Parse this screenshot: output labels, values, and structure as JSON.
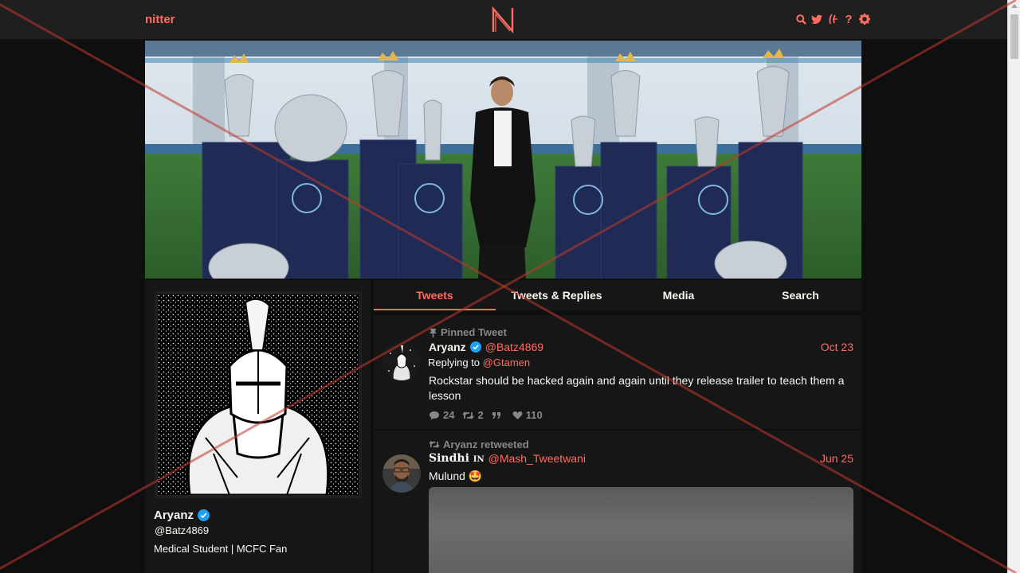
{
  "navbar": {
    "brand": "nitter",
    "logo_letter": "N",
    "icons": [
      "search-icon",
      "twitter-icon",
      "rss-icon",
      "help-icon",
      "settings-icon"
    ]
  },
  "profile": {
    "name": "Aryanz",
    "handle": "@Batz4869",
    "bio": "Medical Student | MCFC Fan",
    "verified": true
  },
  "tabs": [
    {
      "label": "Tweets",
      "active": true
    },
    {
      "label": "Tweets & Replies",
      "active": false
    },
    {
      "label": "Media",
      "active": false
    },
    {
      "label": "Search",
      "active": false
    }
  ],
  "tweets": [
    {
      "pinned_label": "Pinned Tweet",
      "name": "Aryanz",
      "username": "@Batz4869",
      "date": "Oct 23",
      "replying_prefix": "Replying to",
      "replying_to": "@Gtamen",
      "text": "Rockstar should be hacked again and again until they release trailer to teach them a lesson",
      "replies": "24",
      "retweets": "2",
      "quotes": "",
      "likes": "110"
    },
    {
      "retweet_label": "Aryanz retweeted",
      "name": "Sindhi",
      "name_suffix": "IN",
      "username": "@Mash_Tweetwani",
      "date": "Jun 25",
      "text": "Mulund",
      "emoji": "🤩"
    }
  ],
  "colors": {
    "accent": "#ff6c60",
    "background": "#0f0f0f",
    "panel": "#161616",
    "navbar": "#1f1f1f",
    "muted": "#888889",
    "verified": "#1da1f2",
    "overlay_cross": "#c0392b"
  }
}
